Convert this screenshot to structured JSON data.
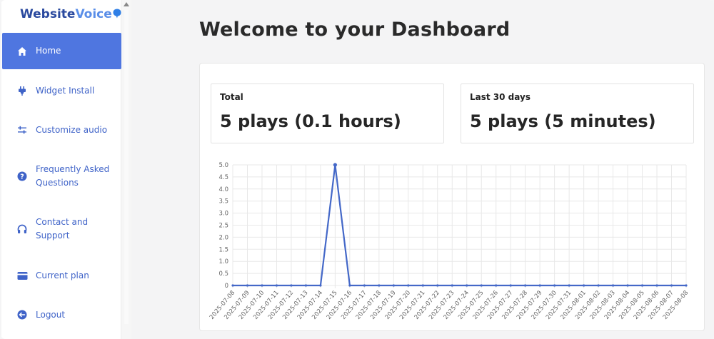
{
  "app": {
    "logo_part1": "Website",
    "logo_part2": "Voice"
  },
  "sidebar": {
    "items": [
      {
        "label": "Home",
        "icon": "home-icon",
        "active": true
      },
      {
        "label": "Widget Install",
        "icon": "plug-icon",
        "active": false
      },
      {
        "label": "Customize audio",
        "icon": "sliders-icon",
        "active": false
      },
      {
        "label": "Frequently Asked Questions",
        "icon": "question-icon",
        "active": false
      },
      {
        "label": "Contact and Support",
        "icon": "headphones-icon",
        "active": false
      },
      {
        "label": "Current plan",
        "icon": "credit-card-icon",
        "active": false
      },
      {
        "label": "Logout",
        "icon": "logout-icon",
        "active": false
      }
    ]
  },
  "main": {
    "title": "Welcome to your Dashboard",
    "stats": [
      {
        "label": "Total",
        "value": "5 plays (0.1 hours)"
      },
      {
        "label": "Last 30 days",
        "value": "5 plays (5 minutes)"
      }
    ]
  },
  "colors": {
    "accent": "#4f76e0",
    "nav_text": "#3f63c8",
    "line": "#4468c8",
    "grid": "#e8e8e8"
  },
  "chart_data": {
    "type": "line",
    "title": "",
    "xlabel": "",
    "ylabel": "",
    "ylim": [
      0,
      5
    ],
    "yticks": [
      "0",
      "0.5",
      "1.0",
      "1.5",
      "2.0",
      "2.5",
      "3.0",
      "3.5",
      "4.0",
      "4.5",
      "5.0"
    ],
    "grid": true,
    "legend": "none",
    "x": [
      "2025-07-08",
      "2025-07-09",
      "2025-07-10",
      "2025-07-11",
      "2025-07-12",
      "2025-07-13",
      "2025-07-14",
      "2025-07-15",
      "2025-07-16",
      "2025-07-17",
      "2025-07-18",
      "2025-07-19",
      "2025-07-20",
      "2025-07-21",
      "2025-07-22",
      "2025-07-23",
      "2025-07-24",
      "2025-07-25",
      "2025-07-26",
      "2025-07-27",
      "2025-07-28",
      "2025-07-29",
      "2025-07-30",
      "2025-07-31",
      "2025-08-01",
      "2025-08-02",
      "2025-08-03",
      "2025-08-04",
      "2025-08-05",
      "2025-08-06",
      "2025-08-07",
      "2025-08-08"
    ],
    "values": [
      0,
      0,
      0,
      0,
      0,
      0,
      0,
      5,
      0,
      0,
      0,
      0,
      0,
      0,
      0,
      0,
      0,
      0,
      0,
      0,
      0,
      0,
      0,
      0,
      0,
      0,
      0,
      0,
      0,
      0,
      0,
      0
    ]
  }
}
